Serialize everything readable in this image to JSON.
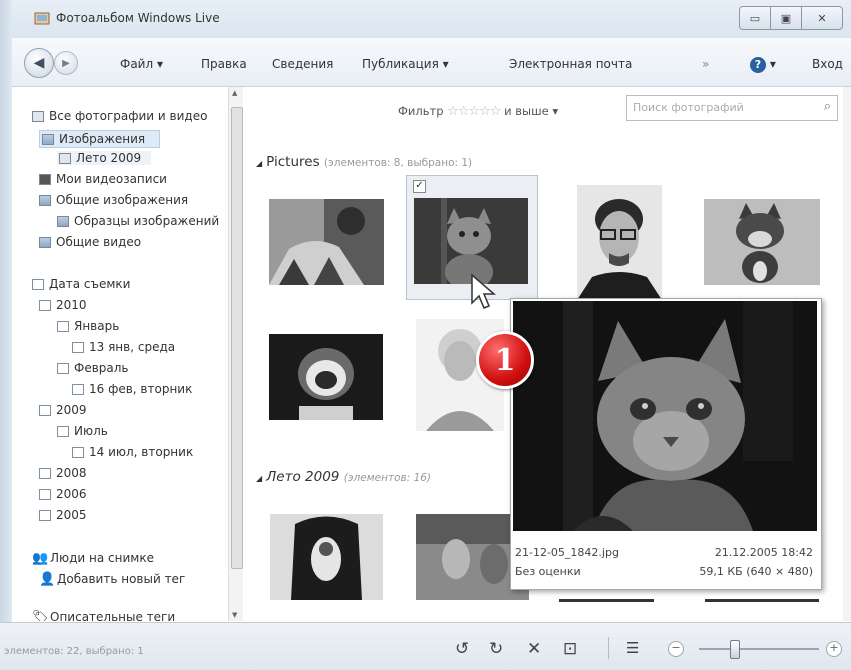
{
  "window": {
    "title": "Фотоальбом Windows Live",
    "buttons": {
      "minimize": "▭",
      "maximize": "▣",
      "close": "✕"
    }
  },
  "toolbar": {
    "back_icon": "back-arrow-icon",
    "forward_icon": "forward-arrow-icon",
    "file": "Файл ▾",
    "edit": "Правка",
    "info": "Сведения",
    "publish": "Публикация ▾",
    "email": "Электронная почта",
    "more": "»",
    "help": "❷ ▾",
    "signin": "Вход"
  },
  "sidebar": {
    "items": [
      {
        "label": "Все фотографии и видео",
        "icon": "gallery-icon"
      },
      {
        "label": "Изображения",
        "icon": "pictures-folder-icon",
        "selected": true
      },
      {
        "label": "Лето 2009",
        "icon": "folder-icon"
      },
      {
        "label": "Мои видеозаписи",
        "icon": "video-folder-icon"
      },
      {
        "label": "Общие изображения",
        "icon": "folder-icon"
      },
      {
        "label": "Образцы изображений",
        "icon": "folder-icon"
      },
      {
        "label": "Общие видео",
        "icon": "folder-icon"
      },
      {
        "label": "Дата съемки",
        "icon": "calendar-icon"
      },
      {
        "label": "2010",
        "icon": "calendar-icon"
      },
      {
        "label": "Январь",
        "icon": "calendar-icon"
      },
      {
        "label": "13 янв, среда",
        "icon": "calendar-icon"
      },
      {
        "label": "Февраль",
        "icon": "calendar-icon"
      },
      {
        "label": "16 фев, вторник",
        "icon": "calendar-icon"
      },
      {
        "label": "2009",
        "icon": "calendar-icon"
      },
      {
        "label": "Июль",
        "icon": "calendar-icon"
      },
      {
        "label": "14 июл, вторник",
        "icon": "calendar-icon"
      },
      {
        "label": "2008",
        "icon": "calendar-icon"
      },
      {
        "label": "2006",
        "icon": "calendar-icon"
      },
      {
        "label": "2005",
        "icon": "calendar-icon"
      },
      {
        "label": "Люди на снимке",
        "icon": "people-icon"
      },
      {
        "label": "Добавить новый тег",
        "icon": "add-tag-icon"
      },
      {
        "label": "Описательные теги",
        "icon": "tags-icon"
      }
    ]
  },
  "filter": {
    "label": "Фильтр",
    "stars": "☆☆☆☆☆",
    "suffix": "и выше ▾",
    "search_placeholder": "Поиск фотографий"
  },
  "groups": [
    {
      "name": "Pictures",
      "count": "(элементов: 8, выбрано: 1)"
    },
    {
      "name": "Лето 2009",
      "count": "(элементов: 16)"
    }
  ],
  "preview": {
    "filename": "21-12-05_1842.jpg",
    "datetime": "21.12.2005  18:42",
    "rating": "Без оценки",
    "size": "59,1 КБ (640 × 480)"
  },
  "badge": "1",
  "status": {
    "text": "элементов: 22, выбрано: 1",
    "zoom_level": 0.3
  },
  "colors": {
    "selection": "#dfeaf7",
    "badge": "#d01010"
  }
}
